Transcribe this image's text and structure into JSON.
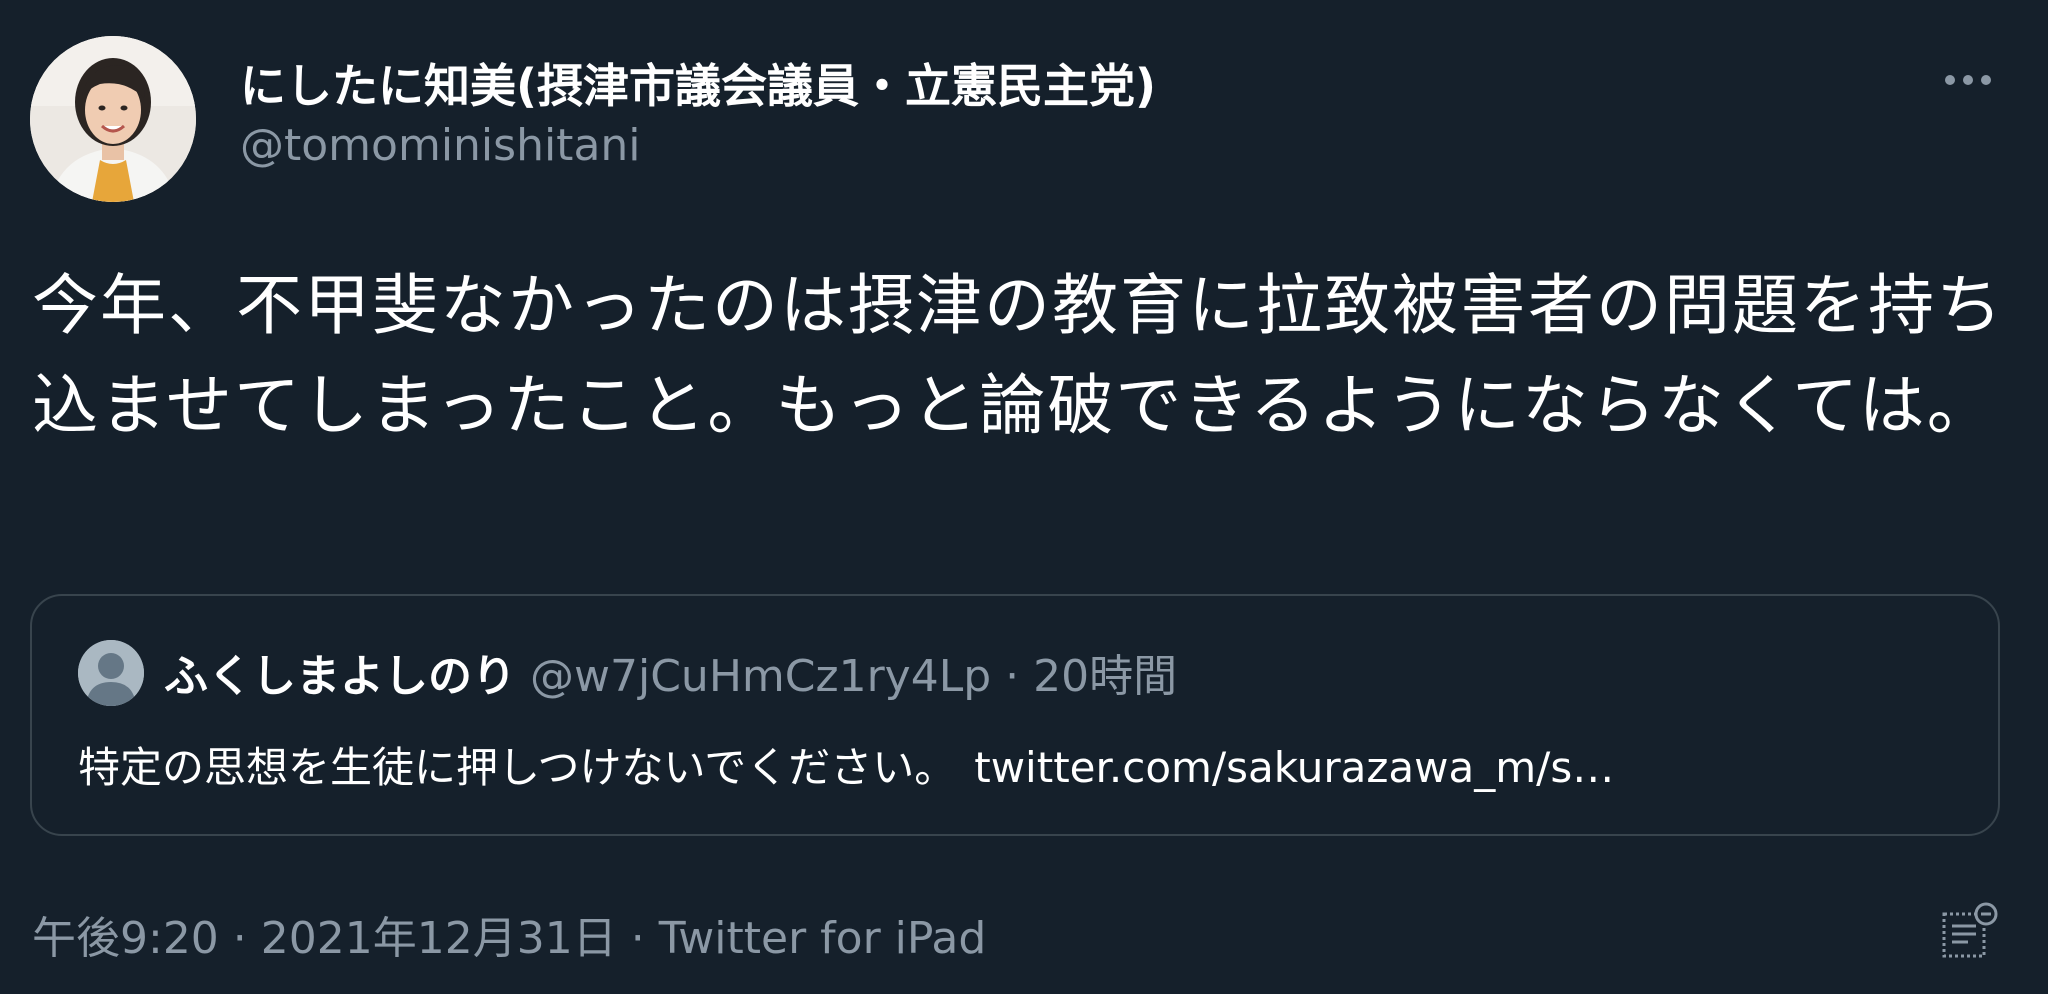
{
  "author": {
    "display_name": "にしたに知美(摂津市議会議員・立憲民主党)",
    "handle": "@tomominishitani",
    "avatar": "user-photo"
  },
  "tweet": {
    "text": "今年、不甲斐なかったのは摂津の教育に拉致被害者の問題を持ち込ませてしまったこと。もっと論破できるようにならなくては。"
  },
  "quote": {
    "display_name": "ふくしまよしのり",
    "handle": "@w7jCuHmCz1ry4Lp",
    "separator": "·",
    "time": "20時間",
    "text": "特定の思想を生徒に押しつけないでください。",
    "link": "twitter.com/sakurazawa_m/s…",
    "avatar": "default-profile-icon"
  },
  "meta": {
    "time": "午後9:20",
    "sep1": " · ",
    "date": "2021年12月31日",
    "sep2": " · ",
    "source": "Twitter for iPad"
  },
  "icons": {
    "more": "more-dots-icon",
    "analytics": "analytics-icon"
  },
  "colors": {
    "background": "#15202b",
    "primary_text": "#ffffff",
    "secondary_text": "#8b98a5",
    "border": "#38444d"
  }
}
